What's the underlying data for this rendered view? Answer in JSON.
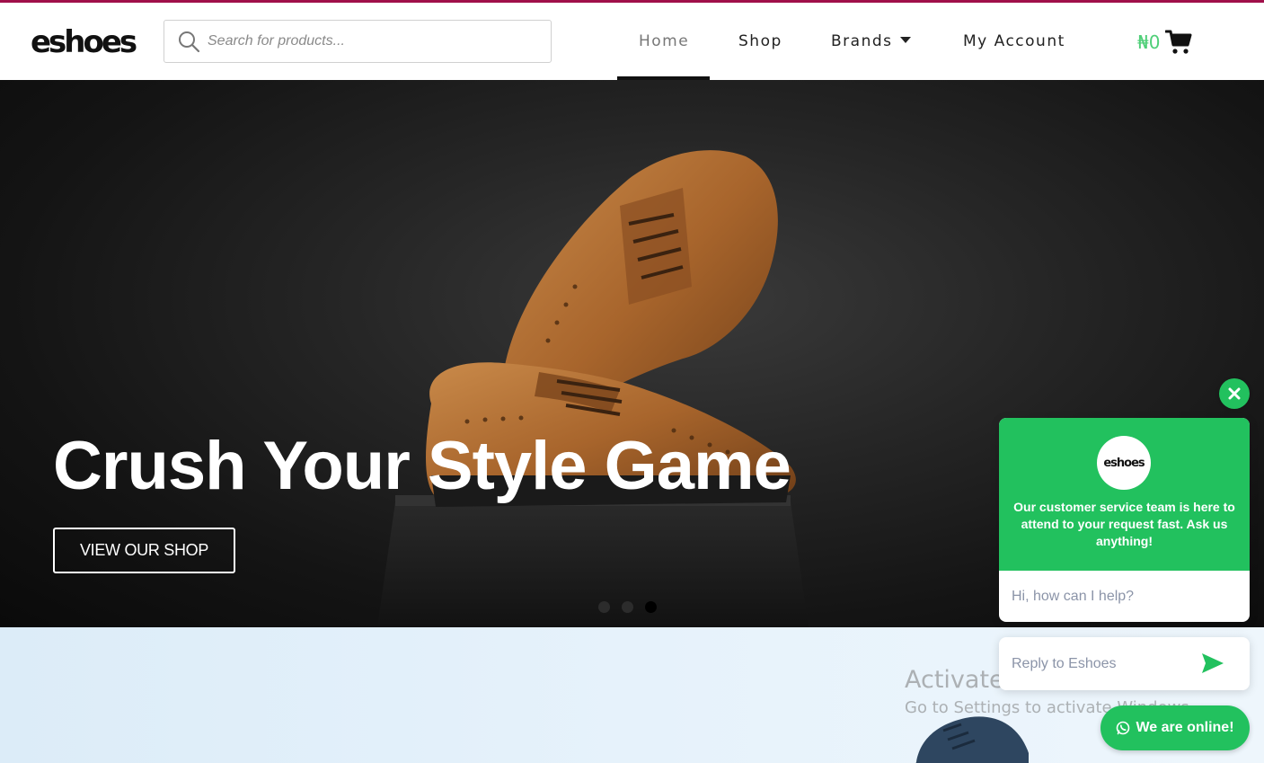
{
  "header": {
    "logo_text": "eshoes",
    "search": {
      "placeholder": "Search for products...",
      "value": ""
    },
    "nav": {
      "home": "Home",
      "shop": "Shop",
      "brands": "Brands",
      "account": "My Account"
    },
    "cart_amount": "₦0"
  },
  "hero": {
    "title": "Crush Your Style Game",
    "button_label": "VIEW OUR SHOP",
    "slides_total": 3,
    "active_slide": 3
  },
  "chat": {
    "avatar_text": "eshoes",
    "intro": "Our customer service team is here to attend to your request fast. Ask us anything!",
    "bubble": "Hi, how can I help?",
    "reply_placeholder": "Reply to Eshoes",
    "online_label": "We are online!"
  },
  "watermark": {
    "title": "Activate Windows",
    "subtitle": "Go to Settings to activate Windows."
  },
  "colors": {
    "accent_line": "#a0104a",
    "chat_green": "#22c15e",
    "cart_green": "#4fcf78"
  },
  "icons": [
    "search-icon",
    "chevron-down-icon",
    "cart-icon",
    "close-icon",
    "send-icon",
    "whatsapp-icon"
  ]
}
